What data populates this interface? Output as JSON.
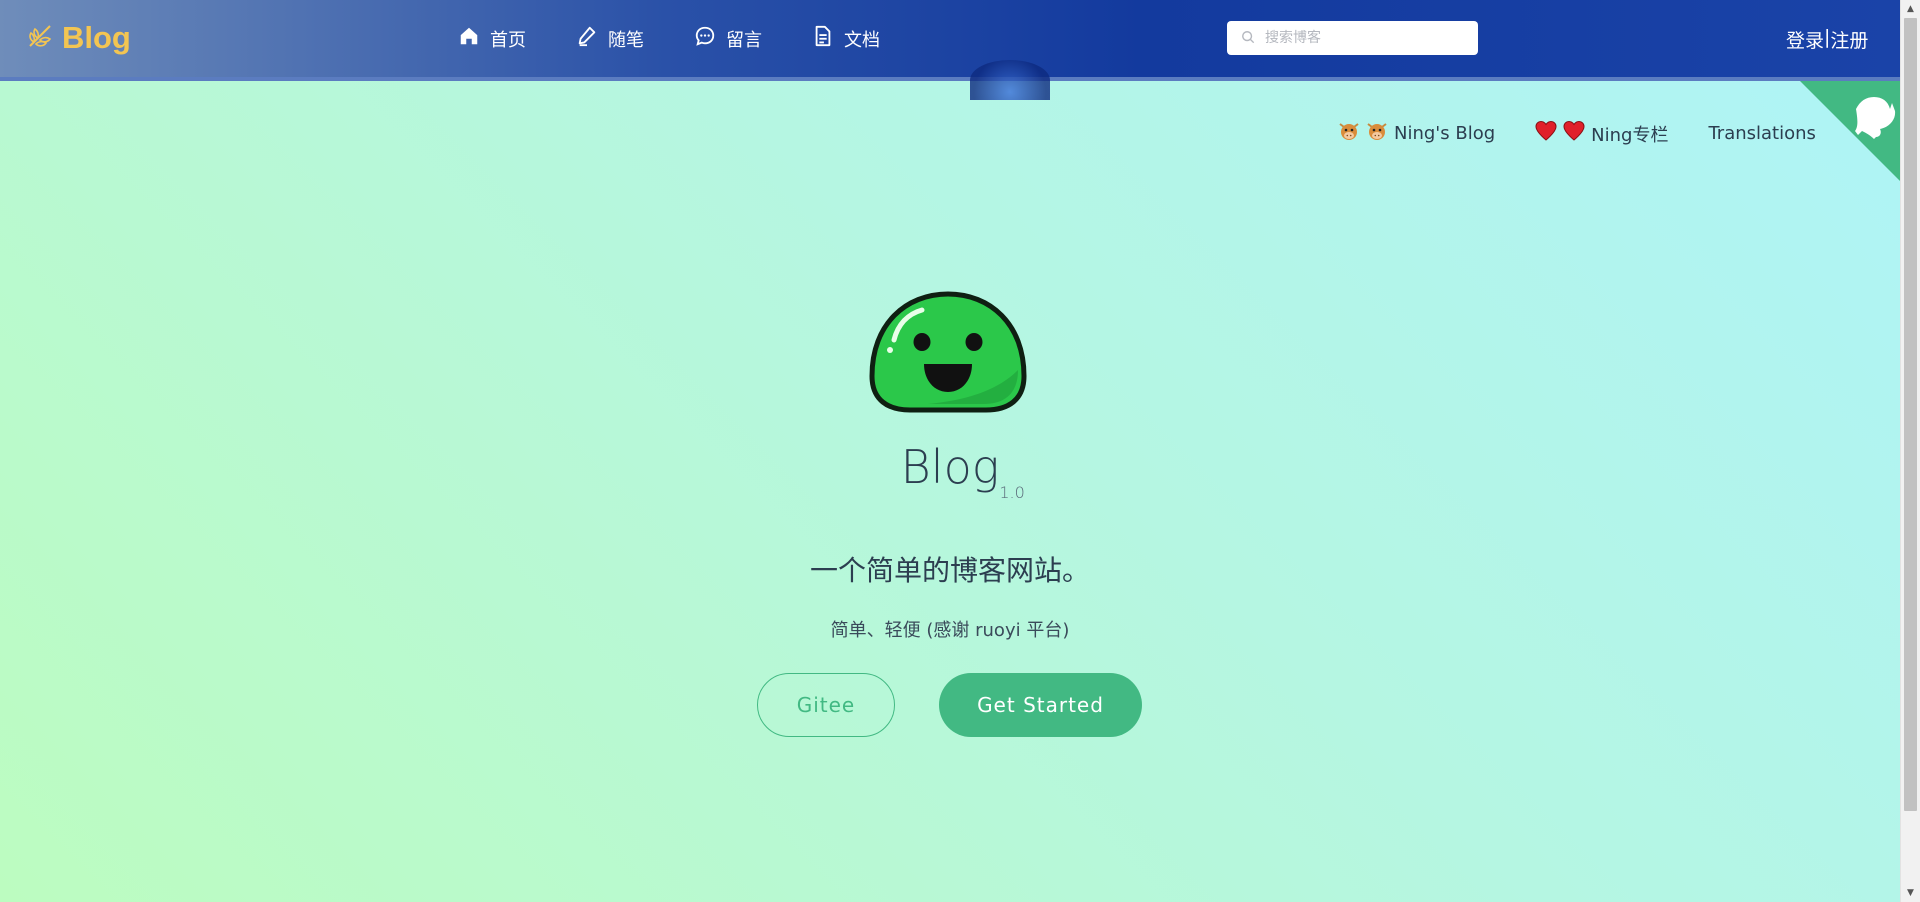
{
  "header": {
    "brand": "Blog",
    "nav": [
      {
        "label": "首页",
        "icon": "home-icon"
      },
      {
        "label": "随笔",
        "icon": "pen-icon"
      },
      {
        "label": "留言",
        "icon": "chat-icon"
      },
      {
        "label": "文档",
        "icon": "document-icon"
      }
    ],
    "search": {
      "placeholder": "搜索博客"
    },
    "auth": {
      "login": "登录",
      "separator": "|",
      "register": "注册"
    }
  },
  "top_links": [
    {
      "label": "Ning's Blog",
      "icon": "cow-icon"
    },
    {
      "label": "Ning专栏",
      "icon": "heart-icon"
    },
    {
      "label": "Translations",
      "icon": ""
    }
  ],
  "hero": {
    "title": "Blog",
    "version": "1.0",
    "description": "一个简单的博客网站。",
    "subtitle": "简单、轻便 (感谢 ruoyi 平台)",
    "gitee_button": "Gitee",
    "start_button": "Get Started"
  },
  "colors": {
    "accent": "#42b983",
    "brand": "#f3c552",
    "navbar": "#1a43a8"
  }
}
